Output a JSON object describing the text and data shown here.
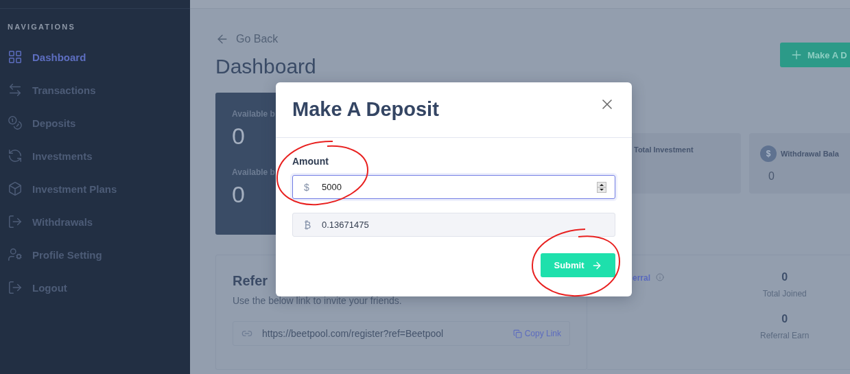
{
  "sidebar": {
    "heading": "NAVIGATIONS",
    "items": [
      {
        "label": "Dashboard",
        "selected": true
      },
      {
        "label": "Transactions",
        "selected": false
      },
      {
        "label": "Deposits",
        "selected": false
      },
      {
        "label": "Investments",
        "selected": false
      },
      {
        "label": "Investment Plans",
        "selected": false
      },
      {
        "label": "Withdrawals",
        "selected": false
      },
      {
        "label": "Profile Setting",
        "selected": false
      },
      {
        "label": "Logout",
        "selected": false
      }
    ]
  },
  "back_link": "Go Back",
  "title": "Dashboard",
  "action_button": "Make A D",
  "balance_card": {
    "items": [
      {
        "label": "Available b",
        "value": "0"
      },
      {
        "label": "Available b",
        "value": "0"
      }
    ]
  },
  "stat_cards": [
    {
      "label": "Total Investment"
    },
    {
      "badge": "$",
      "label": "Withdrawal Bala",
      "value": "0"
    }
  ],
  "refer_card": {
    "title": "Refer",
    "text": "Use the below link to invite your friends.",
    "link": "https://beetpool.com/register?ref=Beetpool",
    "copy": "Copy Link"
  },
  "referral_card": {
    "link": "erral",
    "stats": [
      {
        "value": "0",
        "label": "Total Joined"
      },
      {
        "value": "0",
        "label": "Referral Earn"
      }
    ]
  },
  "modal": {
    "title": "Make A Deposit",
    "amount_label": "Amount",
    "amount": {
      "prefix": "$",
      "value": "5000"
    },
    "converted": {
      "prefix": "₿",
      "value": "0.13671475"
    },
    "submit": "Submit"
  }
}
